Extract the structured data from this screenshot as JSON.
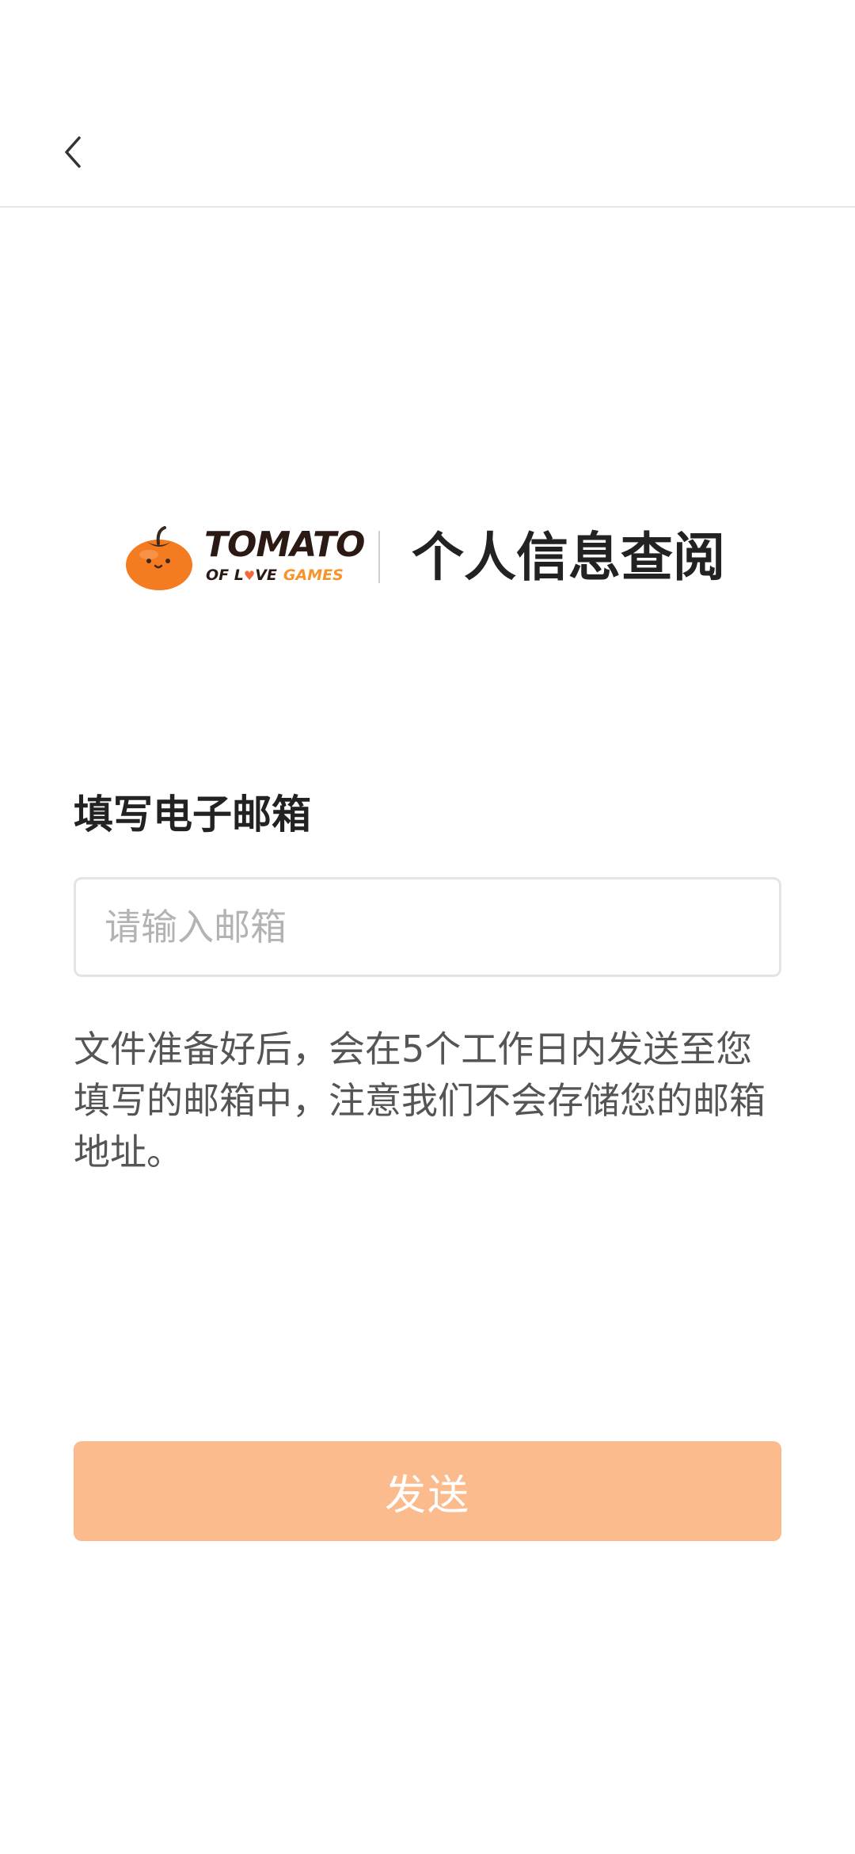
{
  "header": {
    "back_icon": "chevron-left-icon"
  },
  "brand": {
    "logo_line_1": "TOMATO",
    "logo_line_2_part_1": "OF L",
    "logo_line_2_heart": "♥",
    "logo_line_2_part_2": "VE",
    "logo_line_2_part_3": "GAMES",
    "title": "个人信息查阅",
    "colors": {
      "tomato_orange": "#f47b20",
      "accent_orange": "#f6942b",
      "logo_dark": "#2b1a14"
    }
  },
  "form": {
    "section_label": "填写电子邮箱",
    "email_placeholder": "请输入邮箱",
    "email_value": "",
    "notice": "文件准备好后，会在5个工作日内发送至您填写的邮箱中，注意我们不会存储您的邮箱地址。",
    "submit_label": "发送",
    "submit_color": "#fbbb8c"
  }
}
